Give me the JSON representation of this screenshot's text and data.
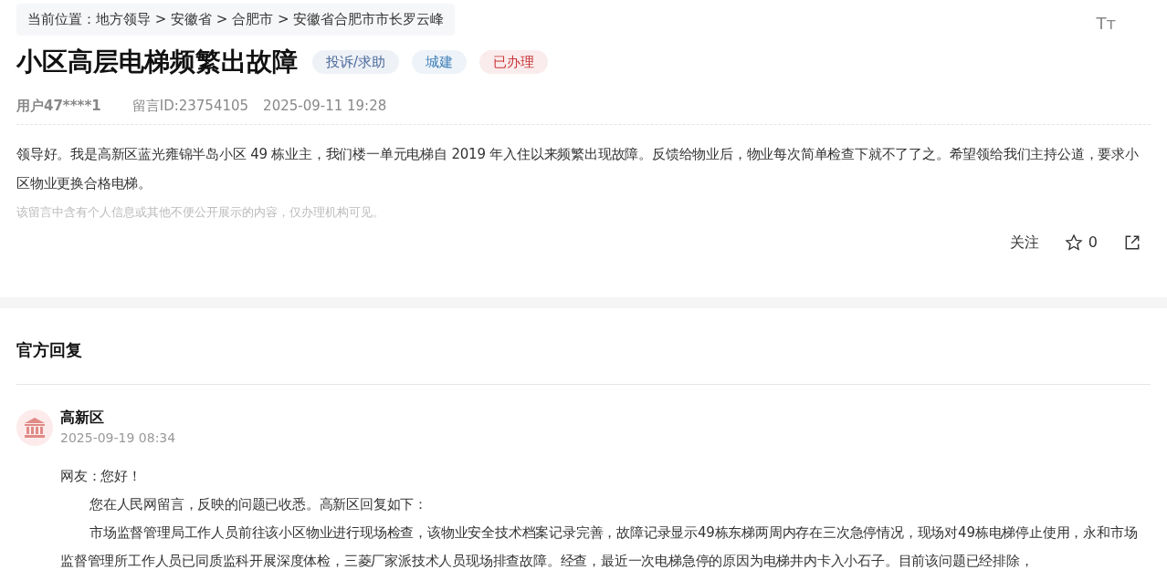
{
  "breadcrumb": "当前位置：地方领导 > 安徽省 > 合肥市 > 安徽省合肥市市长罗云峰",
  "font_size_toggle": {
    "label": "Tт"
  },
  "title": "小区高层电梯频繁出故障",
  "tags": [
    {
      "label": "投诉/求助",
      "color": "#4b6a9b"
    },
    {
      "label": "城建",
      "color": "#3f7fb8"
    },
    {
      "label": "已办理",
      "color": "#c9353a"
    }
  ],
  "meta": {
    "user": "用户47****1",
    "message_id": "留言ID:23754105",
    "time": "2025-09-11 19:28"
  },
  "message": "领导好。我是高新区蓝光雍锦半岛小区 49 栋业主，我们楼一单元电梯自 2019 年入住以来频繁出现故障。反馈给物业后，物业每次简单检查下就不了了之。希望领给我们主持公道，要求小区物业更换合格电梯。",
  "privacy_note": "该留言中含有个人信息或其他不便公开展示的内容，仅办理机构可见。",
  "actions": {
    "follow": "关注",
    "likes": "0"
  },
  "reply": {
    "heading": "官方回复",
    "org": "高新区",
    "time": "2025-09-19 08:34",
    "greeting": "网友：您好！",
    "paragraphs": [
      "您在人民网留言，反映的问题已收悉。高新区回复如下：",
      "市场监督管理局工作人员前往该小区物业进行现场检查，该物业安全技术档案记录完善，故障记录显示49栋东梯两周内存在三次急停情况，现场对49栋电梯停止使用，永和市场监督管理所工作人员已同质监科开展深度体检，三菱厂家派技术人员现场排查故障。经查，最近一次电梯急停的原因为电梯井内卡入小石子。目前该问题已经排除，"
    ]
  }
}
